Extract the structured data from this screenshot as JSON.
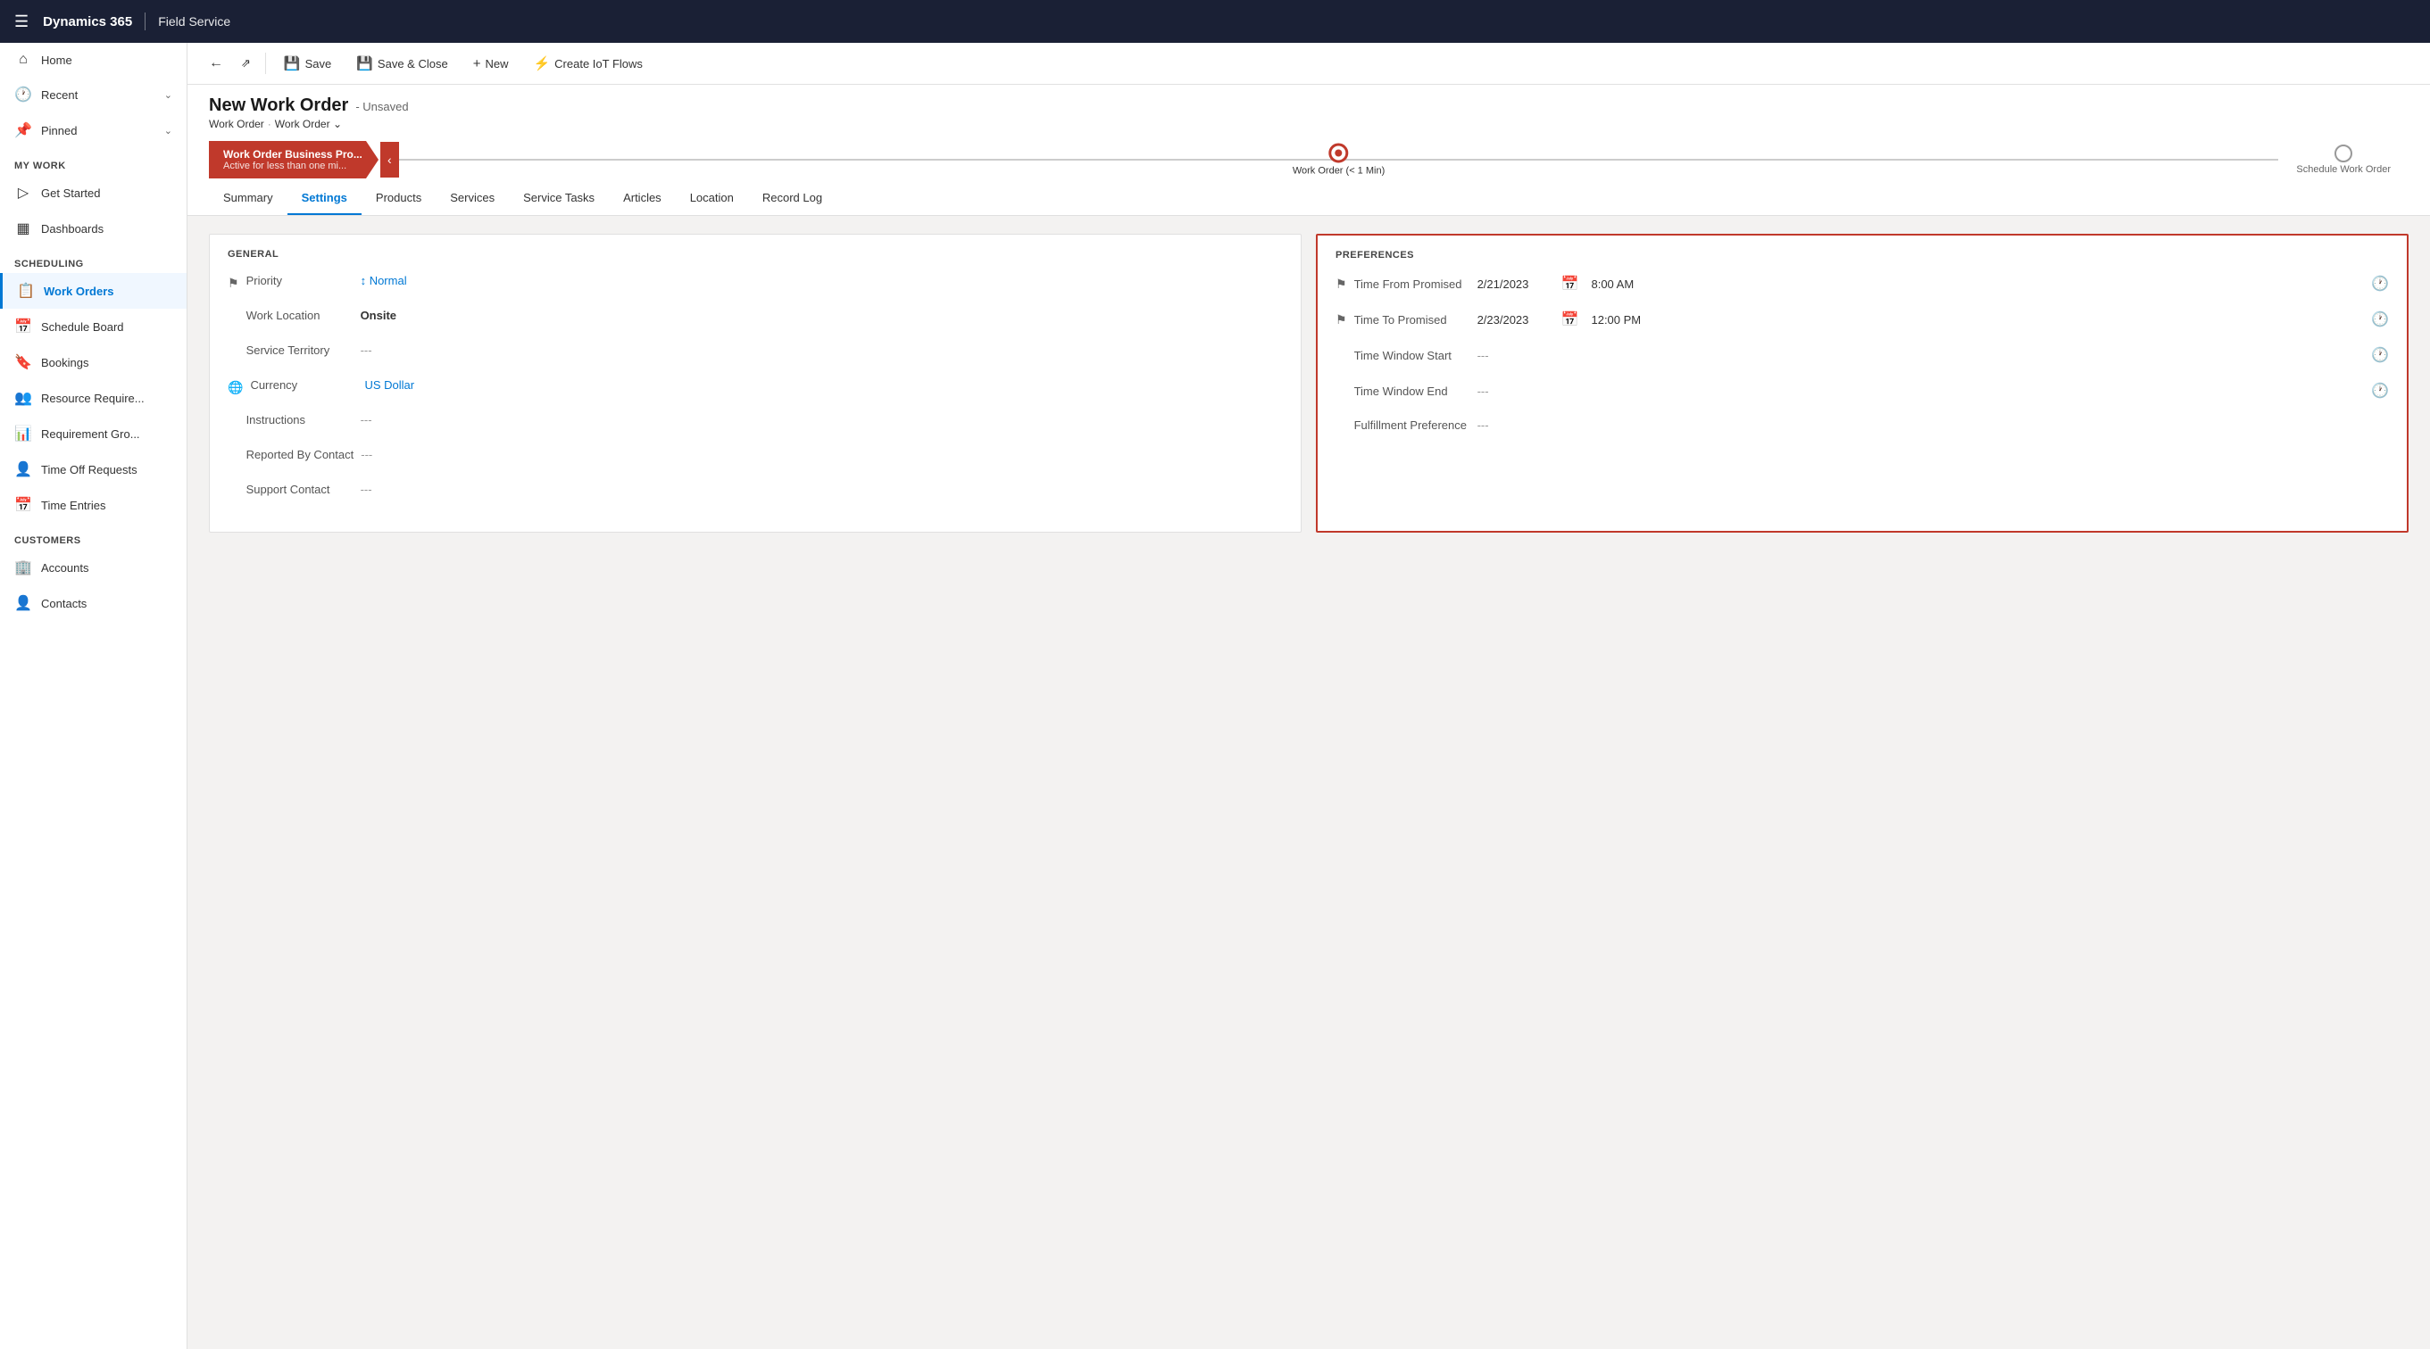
{
  "topnav": {
    "app_name": "Dynamics 365",
    "module_name": "Field Service"
  },
  "toolbar": {
    "back_label": "←",
    "popup_label": "⇗",
    "save_label": "Save",
    "save_close_label": "Save & Close",
    "new_label": "New",
    "create_iot_label": "Create IoT Flows"
  },
  "page": {
    "title": "New Work Order",
    "subtitle": "- Unsaved",
    "breadcrumb1": "Work Order",
    "breadcrumb2": "Work Order",
    "stage_active_title": "Work Order Business Pro...",
    "stage_active_sub": "Active for less than one mi...",
    "stage_active_time": "(< 1 Min)",
    "stage_progress_label": "Work Order",
    "stage_next_label": "Schedule Work Order"
  },
  "tabs": [
    {
      "label": "Summary",
      "active": false
    },
    {
      "label": "Settings",
      "active": true
    },
    {
      "label": "Products",
      "active": false
    },
    {
      "label": "Services",
      "active": false
    },
    {
      "label": "Service Tasks",
      "active": false
    },
    {
      "label": "Articles",
      "active": false
    },
    {
      "label": "Location",
      "active": false
    },
    {
      "label": "Record Log",
      "active": false
    }
  ],
  "general": {
    "section_title": "GENERAL",
    "fields": [
      {
        "id": "priority",
        "icon": "⚑",
        "label": "Priority",
        "value": "Normal",
        "type": "link"
      },
      {
        "id": "work_location",
        "icon": "",
        "label": "Work Location",
        "value": "Onsite",
        "type": "bold"
      },
      {
        "id": "service_territory",
        "icon": "",
        "label": "Service Territory",
        "value": "---",
        "type": "empty"
      },
      {
        "id": "currency",
        "icon": "💱",
        "label": "Currency",
        "value": "US Dollar",
        "type": "link"
      },
      {
        "id": "instructions",
        "icon": "",
        "label": "Instructions",
        "value": "---",
        "type": "empty"
      },
      {
        "id": "reported_by",
        "icon": "",
        "label": "Reported By Contact",
        "value": "---",
        "type": "empty"
      },
      {
        "id": "support_contact",
        "icon": "",
        "label": "Support Contact",
        "value": "---",
        "type": "empty"
      }
    ]
  },
  "preferences": {
    "section_title": "PREFERENCES",
    "time_from_promised_label": "Time From Promised",
    "time_from_promised_date": "2/21/2023",
    "time_from_promised_time": "8:00 AM",
    "time_to_promised_label": "Time To Promised",
    "time_to_promised_date": "2/23/2023",
    "time_to_promised_time": "12:00 PM",
    "time_window_start_label": "Time Window Start",
    "time_window_start_value": "---",
    "time_window_end_label": "Time Window End",
    "time_window_end_value": "---",
    "fulfillment_pref_label": "Fulfillment Preference",
    "fulfillment_pref_value": "---"
  },
  "sidebar": {
    "section_my_work": "My Work",
    "section_scheduling": "Scheduling",
    "section_customers": "Customers",
    "items_top": [
      {
        "id": "home",
        "icon": "⌂",
        "label": "Home"
      },
      {
        "id": "recent",
        "icon": "🕐",
        "label": "Recent",
        "expandable": true
      },
      {
        "id": "pinned",
        "icon": "📌",
        "label": "Pinned",
        "expandable": true
      }
    ],
    "items_mywork": [
      {
        "id": "get-started",
        "icon": "▷",
        "label": "Get Started"
      },
      {
        "id": "dashboards",
        "icon": "▦",
        "label": "Dashboards"
      }
    ],
    "items_scheduling": [
      {
        "id": "work-orders",
        "icon": "📋",
        "label": "Work Orders",
        "active": true
      },
      {
        "id": "schedule-board",
        "icon": "📅",
        "label": "Schedule Board"
      },
      {
        "id": "bookings",
        "icon": "🔖",
        "label": "Bookings"
      },
      {
        "id": "resource-req",
        "icon": "👥",
        "label": "Resource Require..."
      },
      {
        "id": "requirement-gro",
        "icon": "📊",
        "label": "Requirement Gro..."
      },
      {
        "id": "time-off",
        "icon": "👤",
        "label": "Time Off Requests"
      },
      {
        "id": "time-entries",
        "icon": "📅",
        "label": "Time Entries"
      }
    ],
    "items_customers": [
      {
        "id": "accounts",
        "icon": "🏢",
        "label": "Accounts"
      },
      {
        "id": "contacts",
        "icon": "👤",
        "label": "Contacts"
      }
    ]
  }
}
